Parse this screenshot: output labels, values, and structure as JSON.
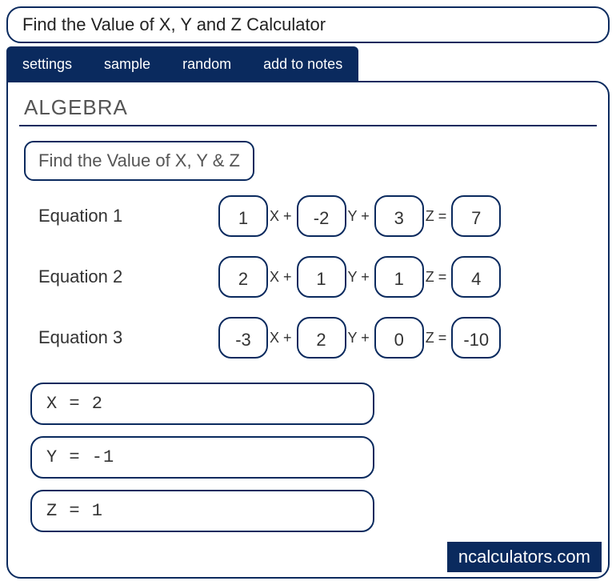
{
  "title": "Find the Value of X, Y and Z Calculator",
  "tabs": {
    "settings": "settings",
    "sample": "sample",
    "random": "random",
    "add_to_notes": "add to notes"
  },
  "category": "ALGEBRA",
  "subtitle": "Find the Value of X, Y & Z",
  "labels": {
    "eq1": "Equation 1",
    "eq2": "Equation 2",
    "eq3": "Equation 3",
    "x_plus": "X +",
    "y_plus": "Y +",
    "z_eq": "Z ="
  },
  "equations": {
    "eq1": {
      "a": "1",
      "b": "-2",
      "c": "3",
      "d": "7"
    },
    "eq2": {
      "a": "2",
      "b": "1",
      "c": "1",
      "d": "4"
    },
    "eq3": {
      "a": "-3",
      "b": "2",
      "c": "0",
      "d": "-10"
    }
  },
  "results": {
    "x": "X = 2",
    "y": "Y = -1",
    "z": "Z = 1"
  },
  "brand": "ncalculators.com"
}
